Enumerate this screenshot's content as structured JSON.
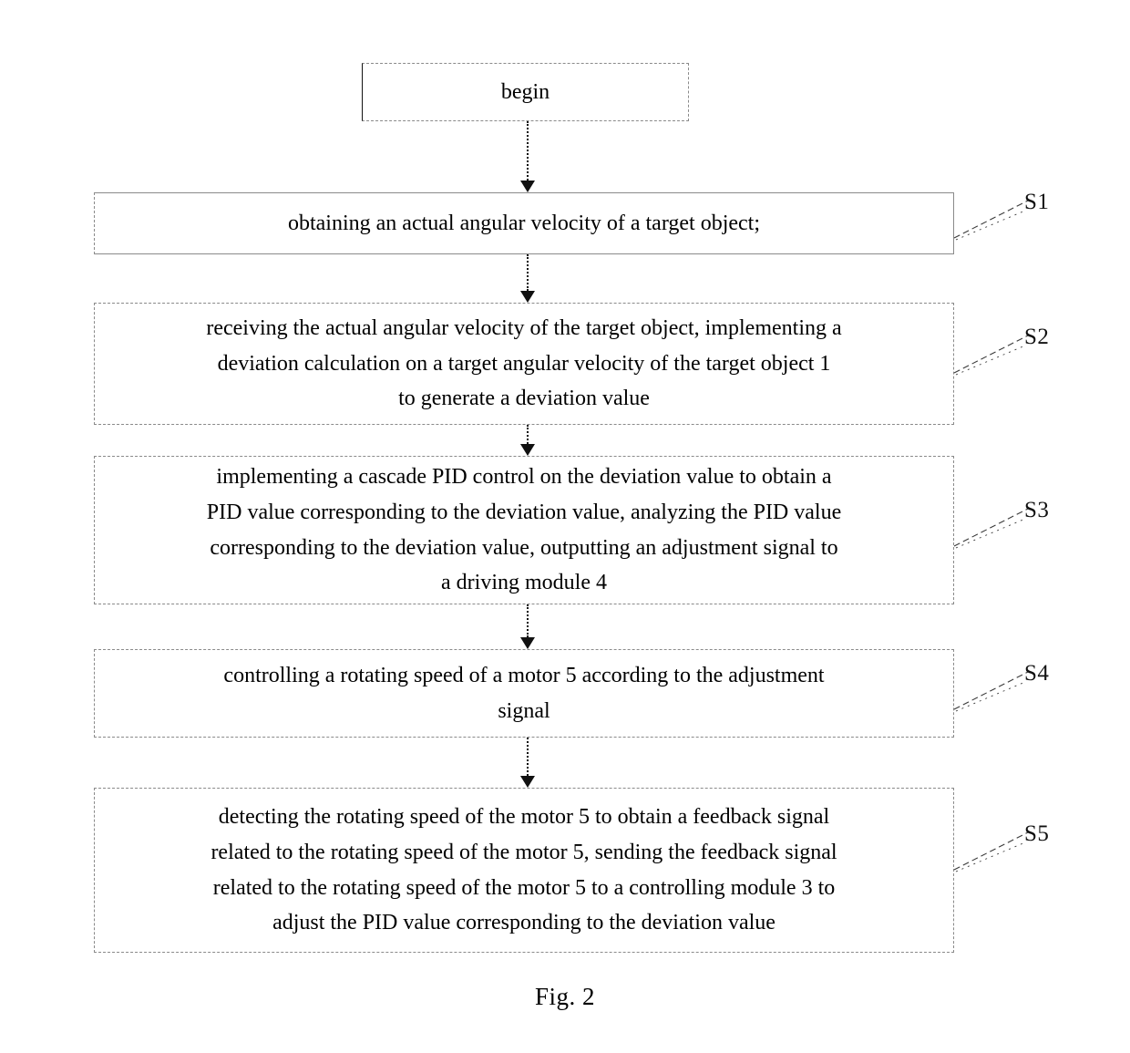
{
  "figure": {
    "caption": "Fig. 2"
  },
  "flowchart": {
    "nodes": [
      {
        "id": "begin",
        "text": "begin",
        "label": ""
      },
      {
        "id": "s1",
        "text": "obtaining an actual angular velocity of a target object;",
        "label": "S1"
      },
      {
        "id": "s2",
        "text": "receiving the actual angular velocity of the target object, implementing a\ndeviation calculation on a target angular velocity of the target object 1\nto generate a deviation value",
        "label": "S2"
      },
      {
        "id": "s3",
        "text": "implementing a cascade PID control on the deviation value to obtain a\nPID value corresponding to the deviation value, analyzing the PID value\ncorresponding to the deviation value, outputting an adjustment signal to\na driving module 4",
        "label": "S3"
      },
      {
        "id": "s4",
        "text": "controlling a rotating speed of a motor 5 according to the adjustment\nsignal",
        "label": "S4"
      },
      {
        "id": "s5",
        "text": "detecting the rotating speed of the motor 5 to obtain a feedback signal\nrelated to the rotating speed of the motor 5, sending the feedback signal\nrelated to the rotating speed of the motor 5 to a controlling module 3 to\nadjust the PID value corresponding to the deviation value",
        "label": "S5"
      }
    ],
    "connectors": [
      {
        "from": "begin",
        "to": "s1"
      },
      {
        "from": "s1",
        "to": "s2"
      },
      {
        "from": "s2",
        "to": "s3"
      },
      {
        "from": "s3",
        "to": "s4"
      },
      {
        "from": "s4",
        "to": "s5"
      }
    ],
    "colors": {
      "box_border": "#8a8a8a",
      "text": "#000000",
      "connector": "#111111",
      "background": "#ffffff"
    }
  }
}
